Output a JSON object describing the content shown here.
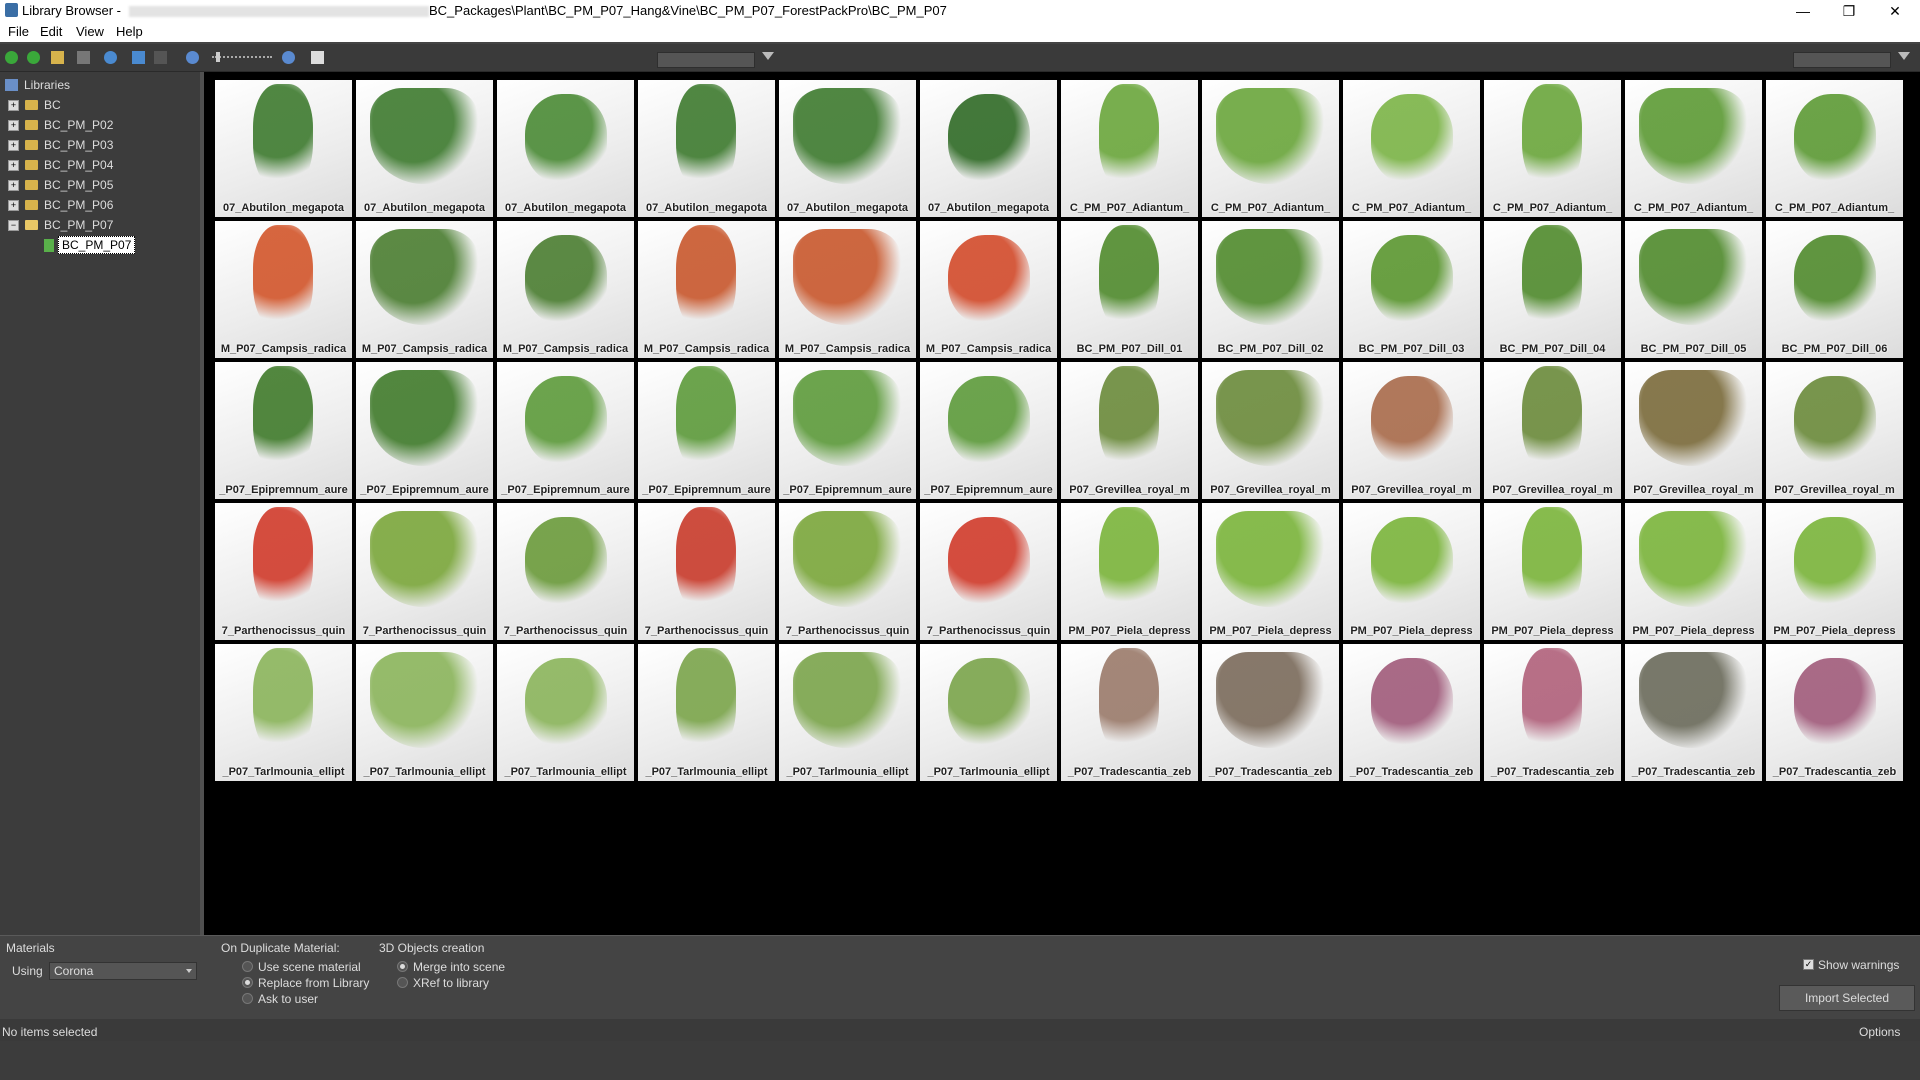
{
  "window": {
    "title_prefix": "Library Browser -",
    "path": "BC_Packages\\Plant\\BC_PM_P07_Hang&Vine\\BC_PM_P07_ForestPackPro\\BC_PM_P07",
    "minimize": "—",
    "restore": "❐",
    "close": "✕"
  },
  "menu": [
    "File",
    "Edit",
    "View",
    "Help"
  ],
  "tree": {
    "root": "Libraries",
    "items": [
      "BC",
      "BC_PM_P02",
      "BC_PM_P03",
      "BC_PM_P04",
      "BC_PM_P05",
      "BC_PM_P06",
      "BC_PM_P07"
    ],
    "selected_child": "BC_PM_P07"
  },
  "thumbnails": [
    {
      "label": "07_Abutilon_megapota",
      "color": "#3d7a2e"
    },
    {
      "label": "07_Abutilon_megapota",
      "color": "#3d7a2e"
    },
    {
      "label": "07_Abutilon_megapota",
      "color": "#4a8a35"
    },
    {
      "label": "07_Abutilon_megapota",
      "color": "#3d7a2e"
    },
    {
      "label": "07_Abutilon_megapota",
      "color": "#3d7a2e"
    },
    {
      "label": "07_Abutilon_megapota",
      "color": "#2f6a25"
    },
    {
      "label": "C_PM_P07_Adiantum_",
      "color": "#6aa63b"
    },
    {
      "label": "C_PM_P07_Adiantum_",
      "color": "#6aa63b"
    },
    {
      "label": "C_PM_P07_Adiantum_",
      "color": "#7bb446"
    },
    {
      "label": "C_PM_P07_Adiantum_",
      "color": "#6aa63b"
    },
    {
      "label": "C_PM_P07_Adiantum_",
      "color": "#5c9a34"
    },
    {
      "label": "C_PM_P07_Adiantum_",
      "color": "#5c9a34"
    },
    {
      "label": "M_P07_Campsis_radica",
      "color": "#d2552a"
    },
    {
      "label": "M_P07_Campsis_radica",
      "color": "#4a7d30"
    },
    {
      "label": "M_P07_Campsis_radica",
      "color": "#4a7d30"
    },
    {
      "label": "M_P07_Campsis_radica",
      "color": "#c8572c"
    },
    {
      "label": "M_P07_Campsis_radica",
      "color": "#c8572c"
    },
    {
      "label": "M_P07_Campsis_radica",
      "color": "#d24a2a"
    },
    {
      "label": "BC_PM_P07_Dill_01",
      "color": "#4f8a2c"
    },
    {
      "label": "BC_PM_P07_Dill_02",
      "color": "#4f8a2c"
    },
    {
      "label": "BC_PM_P07_Dill_03",
      "color": "#5a962f"
    },
    {
      "label": "BC_PM_P07_Dill_04",
      "color": "#4f8a2c"
    },
    {
      "label": "BC_PM_P07_Dill_05",
      "color": "#4f8a2c"
    },
    {
      "label": "BC_PM_P07_Dill_06",
      "color": "#4f8a2c"
    },
    {
      "label": "_P07_Epipremnum_aure",
      "color": "#3f7a2a"
    },
    {
      "label": "_P07_Epipremnum_aure",
      "color": "#3f7a2a"
    },
    {
      "label": "_P07_Epipremnum_aure",
      "color": "#5c9a3a"
    },
    {
      "label": "_P07_Epipremnum_aure",
      "color": "#5c9a3a"
    },
    {
      "label": "_P07_Epipremnum_aure",
      "color": "#5c9a3a"
    },
    {
      "label": "_P07_Epipremnum_aure",
      "color": "#5c9a3a"
    },
    {
      "label": "P07_Grevillea_royal_m",
      "color": "#6a8a3a"
    },
    {
      "label": "P07_Grevillea_royal_m",
      "color": "#6a8a3a"
    },
    {
      "label": "P07_Grevillea_royal_m",
      "color": "#a86a4a"
    },
    {
      "label": "P07_Grevillea_royal_m",
      "color": "#6a8a3a"
    },
    {
      "label": "P07_Grevillea_royal_m",
      "color": "#7a6a3a"
    },
    {
      "label": "P07_Grevillea_royal_m",
      "color": "#6a8a3a"
    },
    {
      "label": "7_Parthenocissus_quin",
      "color": "#d03a2a"
    },
    {
      "label": "7_Parthenocissus_quin",
      "color": "#7aa63a"
    },
    {
      "label": "7_Parthenocissus_quin",
      "color": "#6a9a3a"
    },
    {
      "label": "7_Parthenocissus_quin",
      "color": "#c83a2a"
    },
    {
      "label": "7_Parthenocissus_quin",
      "color": "#7aa63a"
    },
    {
      "label": "7_Parthenocissus_quin",
      "color": "#d03a2a"
    },
    {
      "label": "PM_P07_Piela_depress",
      "color": "#7ab43a"
    },
    {
      "label": "PM_P07_Piela_depress",
      "color": "#7ab43a"
    },
    {
      "label": "PM_P07_Piela_depress",
      "color": "#7ab43a"
    },
    {
      "label": "PM_P07_Piela_depress",
      "color": "#7ab43a"
    },
    {
      "label": "PM_P07_Piela_depress",
      "color": "#7ab43a"
    },
    {
      "label": "PM_P07_Piela_depress",
      "color": "#7ab43a"
    },
    {
      "label": "_P07_Tarlmounia_ellipt",
      "color": "#8ab45a"
    },
    {
      "label": "_P07_Tarlmounia_ellipt",
      "color": "#8ab45a"
    },
    {
      "label": "_P07_Tarlmounia_ellipt",
      "color": "#8ab45a"
    },
    {
      "label": "_P07_Tarlmounia_ellipt",
      "color": "#7aa44a"
    },
    {
      "label": "_P07_Tarlmounia_ellipt",
      "color": "#7aa44a"
    },
    {
      "label": "_P07_Tarlmounia_ellipt",
      "color": "#7aa44a"
    },
    {
      "label": "_P07_Tradescantia_zeb",
      "color": "#9a7a6a"
    },
    {
      "label": "_P07_Tradescantia_zeb",
      "color": "#7a6a5a"
    },
    {
      "label": "_P07_Tradescantia_zeb",
      "color": "#a05a7a"
    },
    {
      "label": "_P07_Tradescantia_zeb",
      "color": "#b0607a"
    },
    {
      "label": "_P07_Tradescantia_zeb",
      "color": "#6a6a5a"
    },
    {
      "label": "_P07_Tradescantia_zeb",
      "color": "#a05a7a"
    }
  ],
  "bottom": {
    "materials_label": "Materials",
    "using_label": "Using",
    "using_value": "Corona",
    "on_duplicate_label": "On Duplicate Material:",
    "dup_options": [
      "Use scene material",
      "Replace from Library",
      "Ask to user"
    ],
    "dup_selected": 1,
    "objects_label": "3D Objects creation",
    "obj_options": [
      "Merge into scene",
      "XRef to library"
    ],
    "obj_selected": 0,
    "show_warnings": "Show warnings",
    "import_button": "Import Selected"
  },
  "status": {
    "left": "No items selected",
    "right": "Options"
  }
}
